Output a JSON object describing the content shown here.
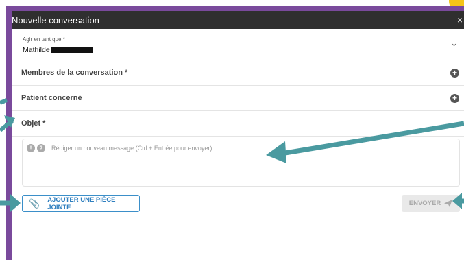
{
  "dialog": {
    "title": "Nouvelle conversation",
    "close_label": "×"
  },
  "acting_as": {
    "label": "Agir en tant que *",
    "value": "Mathilde"
  },
  "sections": {
    "members_label": "Membres de la conversation *",
    "patient_label": "Patient concerné",
    "subject_label": "Objet *"
  },
  "message": {
    "placeholder": "Rédiger un nouveau message (Ctrl + Entrée pour envoyer)"
  },
  "actions": {
    "attach_label": "AJOUTER UNE PIÈCE JOINTE",
    "send_label": "ENVOYER"
  },
  "colors": {
    "annotation_arrow": "#4a9aa0",
    "frame": "#7a4a9c",
    "titlebar": "#2f2f2f",
    "accent": "#2f7fbf"
  }
}
